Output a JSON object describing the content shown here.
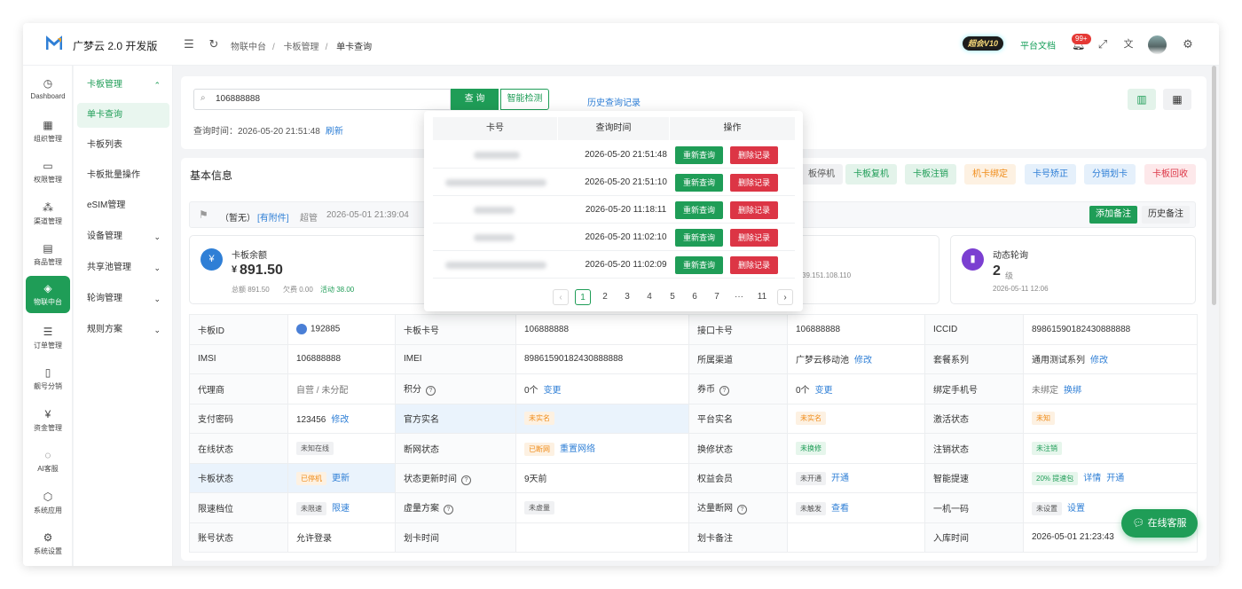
{
  "app": {
    "brand": "广梦云 2.0 开发版"
  },
  "header": {
    "breadcrumb": [
      "物联中台",
      "卡板管理",
      "单卡查询"
    ],
    "vip": "超会V10",
    "doc_link": "平台文档",
    "notif_badge": "99+"
  },
  "rail": [
    {
      "label": "Dashboard",
      "icon": "◷"
    },
    {
      "label": "组织管理",
      "icon": "▦"
    },
    {
      "label": "权限管理",
      "icon": "▭"
    },
    {
      "label": "渠道管理",
      "icon": "⁂"
    },
    {
      "label": "商品管理",
      "icon": "▤"
    },
    {
      "label": "物联中台",
      "icon": "◈"
    },
    {
      "label": "订单管理",
      "icon": "☰"
    },
    {
      "label": "靓号分销",
      "icon": "▯"
    },
    {
      "label": "资金管理",
      "icon": "¥"
    },
    {
      "label": "AI客服",
      "icon": "◌"
    },
    {
      "label": "系统应用",
      "icon": "⬡"
    },
    {
      "label": "系统设置",
      "icon": "⚙"
    }
  ],
  "submenu": [
    "卡板管理",
    "单卡查询",
    "卡板列表",
    "卡板批量操作",
    "eSIM管理",
    "设备管理",
    "共享池管理",
    "轮询管理",
    "规则方案"
  ],
  "search": {
    "value": "106888888",
    "query_btn": "查 询",
    "smart_btn": "智能检测",
    "history_link": "历史查询记录",
    "time_label": "查询时间：2026-05-20 21:51:48",
    "refresh": "刷新"
  },
  "section": {
    "title": "基本信息"
  },
  "actions": [
    "板停机",
    "卡板复机",
    "卡板注销",
    "机卡绑定",
    "卡号矫正",
    "分销划卡",
    "卡板回收"
  ],
  "notes": {
    "status": "（暂无）",
    "attach": "[有附件]",
    "role": "超管",
    "time": "2026-05-01 21:39:04",
    "add_btn": "添加备注",
    "hist_btn": "历史备注"
  },
  "balance": {
    "label": "卡板余额",
    "currency": "¥",
    "amount": "891.50",
    "total": "总额 891.50",
    "debt": "欠费 0.00",
    "active": "活动 38.00"
  },
  "ip": {
    "value": "39.151.108.110"
  },
  "poll": {
    "label": "动态轮询",
    "value": "2",
    "unit": "级",
    "date": "2026-05-11 12:06"
  },
  "grid": {
    "r1": [
      "卡板ID",
      "192885",
      "卡板卡号",
      "106888888",
      "接口卡号",
      "106888888",
      "ICCID",
      "89861590182430888888"
    ],
    "r2": [
      "IMSI",
      "106888888",
      "IMEI",
      "89861590182430888888",
      "所属渠道",
      "广梦云移动池",
      "修改",
      "套餐系列",
      "通用测试系列",
      "修改"
    ],
    "r3": [
      "代理商",
      "自营 / 未分配",
      "积分",
      "0个",
      "变更",
      "券币",
      "0个",
      "变更",
      "绑定手机号",
      "未绑定",
      "换绑"
    ],
    "r4": [
      "支付密码",
      "123456",
      "修改",
      "官方实名",
      "未实名",
      "平台实名",
      "未实名",
      "激活状态",
      "未知"
    ],
    "r5": [
      "在线状态",
      "未知在线",
      "断网状态",
      "已断网",
      "重置网络",
      "换修状态",
      "未换修",
      "注销状态",
      "未注销"
    ],
    "r6": [
      "卡板状态",
      "已停机",
      "更新",
      "状态更新时间",
      "9天前",
      "权益会员",
      "未开通",
      "开通",
      "智能提速",
      "20% 提速包",
      "详情",
      "开通"
    ],
    "r7": [
      "限速档位",
      "未限速",
      "限速",
      "虚量方案",
      "未虚量",
      "达量断网",
      "未触发",
      "查看",
      "一机一码",
      "未设置",
      "设置"
    ],
    "r8": [
      "账号状态",
      "允许登录",
      "划卡时间",
      "",
      "划卡备注",
      "",
      "入库时间",
      "2026-05-01 21:23:43"
    ]
  },
  "history": {
    "headers": [
      "卡号",
      "查询时间",
      "操作"
    ],
    "rows": [
      {
        "time": "2026-05-20 21:51:48"
      },
      {
        "time": "2026-05-20 21:51:10"
      },
      {
        "time": "2026-05-20 11:18:11"
      },
      {
        "time": "2026-05-20 11:02:10"
      },
      {
        "time": "2026-05-20 11:02:09"
      }
    ],
    "requery": "重新查询",
    "delete": "删除记录",
    "pages": [
      "1",
      "2",
      "3",
      "4",
      "5",
      "6",
      "7",
      "···",
      "11"
    ]
  },
  "chat": {
    "label": "在线客服"
  }
}
